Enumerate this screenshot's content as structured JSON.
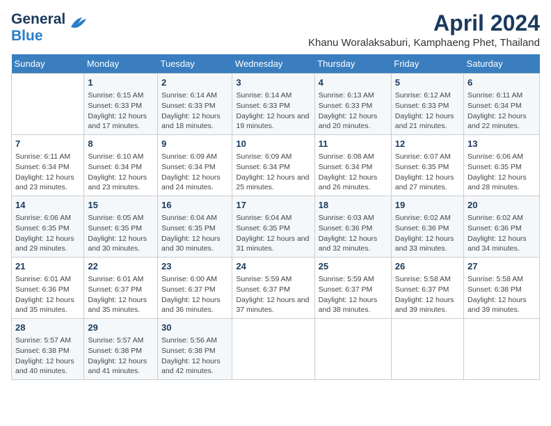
{
  "logo": {
    "line1": "General",
    "line2": "Blue"
  },
  "header": {
    "month_title": "April 2024",
    "location": "Khanu Woralaksaburi, Kamphaeng Phet, Thailand"
  },
  "weekdays": [
    "Sunday",
    "Monday",
    "Tuesday",
    "Wednesday",
    "Thursday",
    "Friday",
    "Saturday"
  ],
  "weeks": [
    [
      {
        "day": null
      },
      {
        "day": "1",
        "sunrise": "6:15 AM",
        "sunset": "6:33 PM",
        "daylight": "12 hours and 17 minutes."
      },
      {
        "day": "2",
        "sunrise": "6:14 AM",
        "sunset": "6:33 PM",
        "daylight": "12 hours and 18 minutes."
      },
      {
        "day": "3",
        "sunrise": "6:14 AM",
        "sunset": "6:33 PM",
        "daylight": "12 hours and 19 minutes."
      },
      {
        "day": "4",
        "sunrise": "6:13 AM",
        "sunset": "6:33 PM",
        "daylight": "12 hours and 20 minutes."
      },
      {
        "day": "5",
        "sunrise": "6:12 AM",
        "sunset": "6:33 PM",
        "daylight": "12 hours and 21 minutes."
      },
      {
        "day": "6",
        "sunrise": "6:11 AM",
        "sunset": "6:34 PM",
        "daylight": "12 hours and 22 minutes."
      }
    ],
    [
      {
        "day": "7",
        "sunrise": "6:11 AM",
        "sunset": "6:34 PM",
        "daylight": "12 hours and 23 minutes."
      },
      {
        "day": "8",
        "sunrise": "6:10 AM",
        "sunset": "6:34 PM",
        "daylight": "12 hours and 23 minutes."
      },
      {
        "day": "9",
        "sunrise": "6:09 AM",
        "sunset": "6:34 PM",
        "daylight": "12 hours and 24 minutes."
      },
      {
        "day": "10",
        "sunrise": "6:09 AM",
        "sunset": "6:34 PM",
        "daylight": "12 hours and 25 minutes."
      },
      {
        "day": "11",
        "sunrise": "6:08 AM",
        "sunset": "6:34 PM",
        "daylight": "12 hours and 26 minutes."
      },
      {
        "day": "12",
        "sunrise": "6:07 AM",
        "sunset": "6:35 PM",
        "daylight": "12 hours and 27 minutes."
      },
      {
        "day": "13",
        "sunrise": "6:06 AM",
        "sunset": "6:35 PM",
        "daylight": "12 hours and 28 minutes."
      }
    ],
    [
      {
        "day": "14",
        "sunrise": "6:06 AM",
        "sunset": "6:35 PM",
        "daylight": "12 hours and 29 minutes."
      },
      {
        "day": "15",
        "sunrise": "6:05 AM",
        "sunset": "6:35 PM",
        "daylight": "12 hours and 30 minutes."
      },
      {
        "day": "16",
        "sunrise": "6:04 AM",
        "sunset": "6:35 PM",
        "daylight": "12 hours and 30 minutes."
      },
      {
        "day": "17",
        "sunrise": "6:04 AM",
        "sunset": "6:35 PM",
        "daylight": "12 hours and 31 minutes."
      },
      {
        "day": "18",
        "sunrise": "6:03 AM",
        "sunset": "6:36 PM",
        "daylight": "12 hours and 32 minutes."
      },
      {
        "day": "19",
        "sunrise": "6:02 AM",
        "sunset": "6:36 PM",
        "daylight": "12 hours and 33 minutes."
      },
      {
        "day": "20",
        "sunrise": "6:02 AM",
        "sunset": "6:36 PM",
        "daylight": "12 hours and 34 minutes."
      }
    ],
    [
      {
        "day": "21",
        "sunrise": "6:01 AM",
        "sunset": "6:36 PM",
        "daylight": "12 hours and 35 minutes."
      },
      {
        "day": "22",
        "sunrise": "6:01 AM",
        "sunset": "6:37 PM",
        "daylight": "12 hours and 35 minutes."
      },
      {
        "day": "23",
        "sunrise": "6:00 AM",
        "sunset": "6:37 PM",
        "daylight": "12 hours and 36 minutes."
      },
      {
        "day": "24",
        "sunrise": "5:59 AM",
        "sunset": "6:37 PM",
        "daylight": "12 hours and 37 minutes."
      },
      {
        "day": "25",
        "sunrise": "5:59 AM",
        "sunset": "6:37 PM",
        "daylight": "12 hours and 38 minutes."
      },
      {
        "day": "26",
        "sunrise": "5:58 AM",
        "sunset": "6:37 PM",
        "daylight": "12 hours and 39 minutes."
      },
      {
        "day": "27",
        "sunrise": "5:58 AM",
        "sunset": "6:38 PM",
        "daylight": "12 hours and 39 minutes."
      }
    ],
    [
      {
        "day": "28",
        "sunrise": "5:57 AM",
        "sunset": "6:38 PM",
        "daylight": "12 hours and 40 minutes."
      },
      {
        "day": "29",
        "sunrise": "5:57 AM",
        "sunset": "6:38 PM",
        "daylight": "12 hours and 41 minutes."
      },
      {
        "day": "30",
        "sunrise": "5:56 AM",
        "sunset": "6:38 PM",
        "daylight": "12 hours and 42 minutes."
      },
      {
        "day": null
      },
      {
        "day": null
      },
      {
        "day": null
      },
      {
        "day": null
      }
    ]
  ],
  "labels": {
    "sunrise_prefix": "Sunrise: ",
    "sunset_prefix": "Sunset: ",
    "daylight_prefix": "Daylight: "
  }
}
